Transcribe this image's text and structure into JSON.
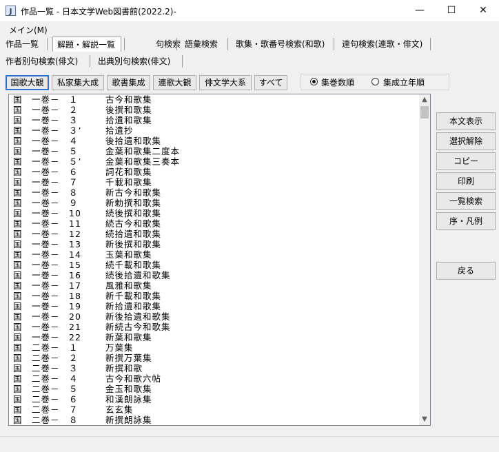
{
  "window": {
    "title": "作品一覧 - 日本文学Web図書館(2022.2)-",
    "app_icon_glyph": "J",
    "minimize_glyph": "—",
    "maximize_glyph": "☐",
    "close_glyph": "✕"
  },
  "menu": {
    "main": "メイン(M)"
  },
  "tabs_row1": [
    "作品一覧",
    "解題・解説一覧",
    "句検索",
    "語彙検索",
    "歌集・歌番号検索(和歌)",
    "連句検索(連歌・俳文)"
  ],
  "tabs_row2": [
    "作者別句検索(俳文)",
    "出典別句検索(俳文)"
  ],
  "active_tab_index": 1,
  "source_buttons": [
    "国歌大観",
    "私家集大成",
    "歌書集成",
    "連歌大観",
    "俳文学大系",
    "すべて"
  ],
  "active_source_index": 0,
  "sort_options": [
    {
      "label": "集巻数順",
      "checked": true
    },
    {
      "label": "集成立年順",
      "checked": false
    }
  ],
  "list_rows": [
    {
      "code": "国　一巻－　１",
      "title": "古今和歌集"
    },
    {
      "code": "国　一巻－　２",
      "title": "後撰和歌集"
    },
    {
      "code": "国　一巻－　３",
      "title": "拾遺和歌集"
    },
    {
      "code": "国　一巻－　３’",
      "title": "拾遺抄"
    },
    {
      "code": "国　一巻－　４",
      "title": "後拾遺和歌集"
    },
    {
      "code": "国　一巻－　５",
      "title": "金葉和歌集二度本"
    },
    {
      "code": "国　一巻－　５’",
      "title": "金葉和歌集三奏本"
    },
    {
      "code": "国　一巻－　６",
      "title": "詞花和歌集"
    },
    {
      "code": "国　一巻－　７",
      "title": "千載和歌集"
    },
    {
      "code": "国　一巻－　８",
      "title": "新古今和歌集"
    },
    {
      "code": "国　一巻－　９",
      "title": "新勅撰和歌集"
    },
    {
      "code": "国　一巻－　10",
      "title": "続後撰和歌集"
    },
    {
      "code": "国　一巻－　11",
      "title": "続古今和歌集"
    },
    {
      "code": "国　一巻－　12",
      "title": "続拾遺和歌集"
    },
    {
      "code": "国　一巻－　13",
      "title": "新後撰和歌集"
    },
    {
      "code": "国　一巻－　14",
      "title": "玉葉和歌集"
    },
    {
      "code": "国　一巻－　15",
      "title": "続千載和歌集"
    },
    {
      "code": "国　一巻－　16",
      "title": "続後拾遺和歌集"
    },
    {
      "code": "国　一巻－　17",
      "title": "風雅和歌集"
    },
    {
      "code": "国　一巻－　18",
      "title": "新千載和歌集"
    },
    {
      "code": "国　一巻－　19",
      "title": "新拾遺和歌集"
    },
    {
      "code": "国　一巻－　20",
      "title": "新後拾遺和歌集"
    },
    {
      "code": "国　一巻－　21",
      "title": "新続古今和歌集"
    },
    {
      "code": "国　一巻－　22",
      "title": "新葉和歌集"
    },
    {
      "code": "国　二巻－　１",
      "title": "万葉集"
    },
    {
      "code": "国　二巻－　２",
      "title": "新撰万葉集"
    },
    {
      "code": "国　二巻－　３",
      "title": "新撰和歌"
    },
    {
      "code": "国　二巻－　４",
      "title": "古今和歌六帖"
    },
    {
      "code": "国　二巻－　５",
      "title": "金玉和歌集"
    },
    {
      "code": "国　二巻－　６",
      "title": "和漢朗詠集"
    },
    {
      "code": "国　二巻－　７",
      "title": "玄玄集"
    },
    {
      "code": "国　二巻－　８",
      "title": "新撰朗詠集"
    }
  ],
  "scroll": {
    "up_glyph": "▲",
    "down_glyph": "▼"
  },
  "side_buttons": [
    "本文表示",
    "選択解除",
    "コピー",
    "印刷",
    "一覧検索",
    "序・凡例"
  ],
  "back_button": "戻る"
}
